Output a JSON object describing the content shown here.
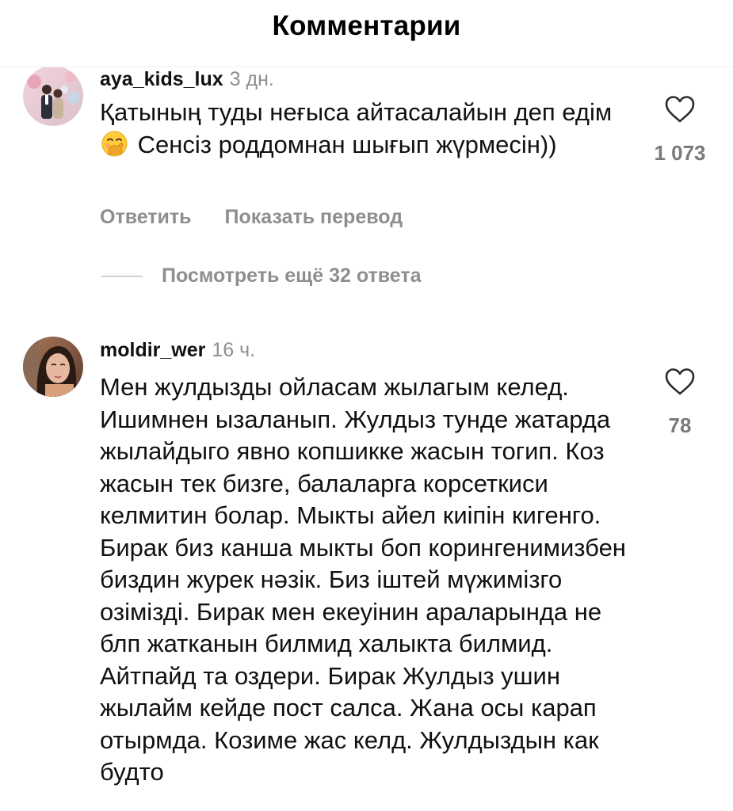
{
  "header": {
    "title": "Комментарии"
  },
  "comments": [
    {
      "username": "aya_kids_lux",
      "time": "3 дн.",
      "text_part1": "Қатының туды неғыса айтасалайын деп едім",
      "emoji": "face-with-hand-over-mouth",
      "text_part2": " Сенсіз роддомнан шығып жүрмесін))",
      "likes": "1 073",
      "reply_label": "Ответить",
      "translate_label": "Показать перевод",
      "view_replies_label": "Посмотреть ещё 32 ответа"
    },
    {
      "username": "moldir_wer",
      "time": "16 ч.",
      "text": "Мен жулдызды ойласам жылагым келед. Ишимнен ызаланып. Жулдыз тунде жатарда жылайдыго явно копшикке жасын тогип. Коз жасын тек бизге, балаларга корсеткиси келмитин болар. Мыкты айел киіпін кигенго. Бирак биз канша мыкты боп корингенимизбен биздин журек нәзік. Биз іштей мүжимізго озімізді. Бирак мен екеуінин араларында не блп жатканын билмид халыкта билмид. Айтпайд та оздери. Бирак Жулдыз ушин жылайм кейде пост салса. Жана осы карап отырмда. Козиме жас келд. Жулдыздын как будто",
      "likes": "78"
    }
  ],
  "icons": {
    "like": "heart-outline-icon"
  },
  "colors": {
    "secondary_text": "#8e8e8e",
    "primary_text": "#111111"
  }
}
